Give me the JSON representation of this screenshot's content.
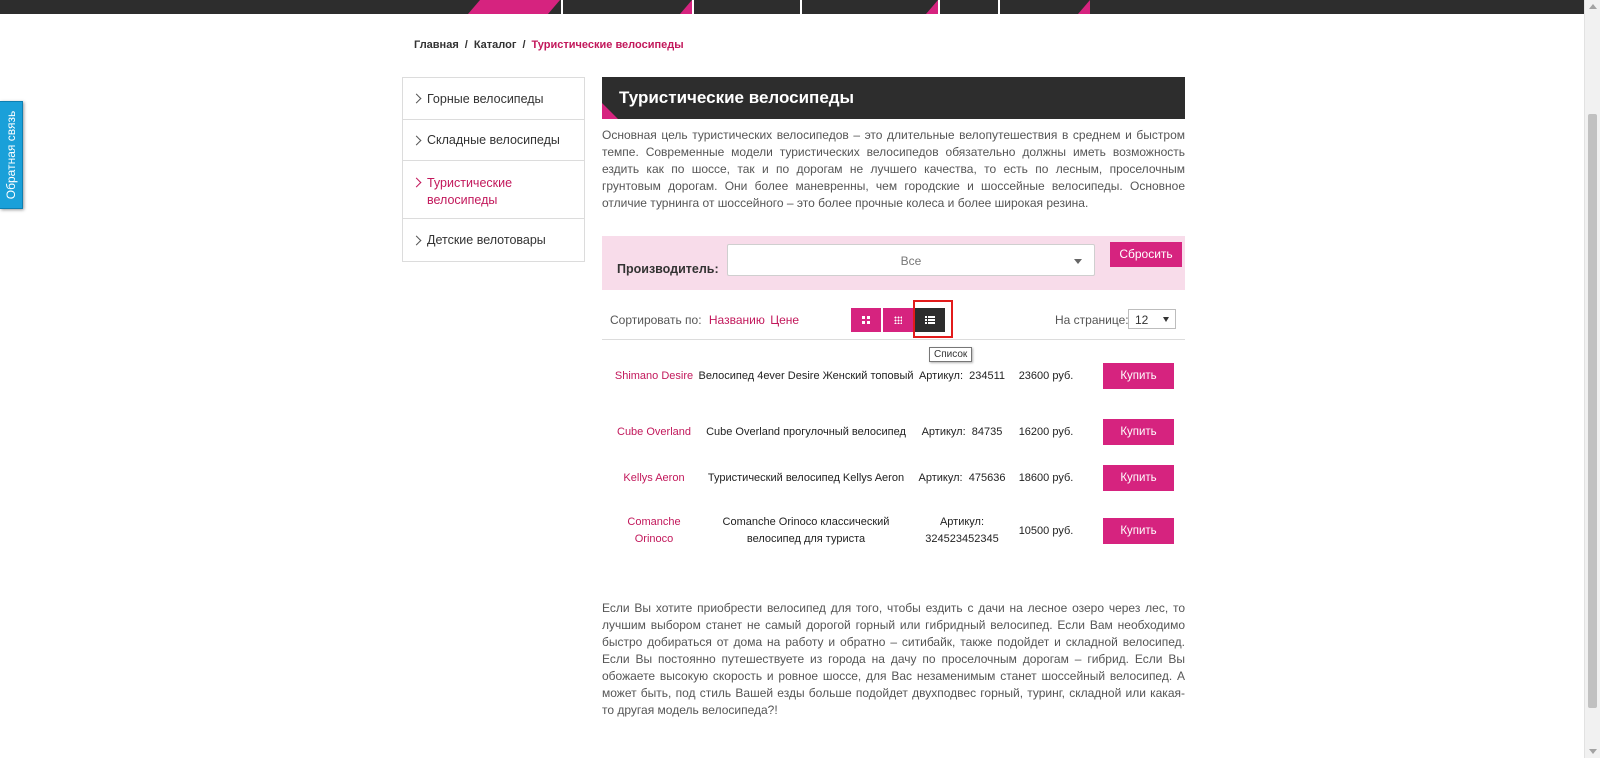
{
  "feedback": {
    "label": "Обратная связь"
  },
  "breadcrumb": {
    "home": "Главная",
    "catalog": "Каталог",
    "current": "Туристические велосипеды",
    "separator": "/"
  },
  "sidebar": {
    "items": [
      {
        "label": "Горные велосипеды",
        "active": false
      },
      {
        "label": "Складные велосипеды",
        "active": false
      },
      {
        "label": "Туристические велосипеды",
        "active": true
      },
      {
        "label": "Детские велотовары",
        "active": false
      }
    ]
  },
  "page": {
    "title": "Туристические велосипеды",
    "description": "Основная цель туристических велосипедов – это длительные велопутешествия в среднем и быстром темпе. Современные модели туристических велосипедов обязательно должны иметь возможность ездить как по шоссе, так и по дорогам не лучшего качества, то есть по лесным, проселочным грунтовым дорогам. Они более маневренны, чем городские и шоссейные велосипеды. Основное отличие турнинга от шоссейного – это более прочные колеса и более широкая резина.",
    "bottom_text": "Если Вы хотите приобрести велосипед для того, чтобы ездить с дачи на лесное озеро через лес, то лучшим выбором станет не самый дорогой горный или гибридный велосипед. Если Вам необходимо быстро добираться от дома на работу и обратно – ситибайк, также подойдет и складной велосипед. Если Вы постоянно путешествуете из города на дачу по проселочным дорогам – гибрид. Если Вы обожаете высокую скорость и ровное шоссе, для Вас незаменимым станет шоссейный велосипед. А может быть, под стиль Вашей езды больше подойдет двухподвес горный, туринг, складной или какая-то другая модель велосипеда?!"
  },
  "filter": {
    "label": "Производитель:",
    "selected": "Все",
    "reset_label": "Сбросить"
  },
  "sort": {
    "label": "Сортировать по:",
    "by_name": "Названию",
    "by_price": "Цене"
  },
  "views": {
    "tooltip": "Список",
    "active": "list"
  },
  "perpage": {
    "label": "На странице:",
    "value": "12"
  },
  "products": [
    {
      "name": "Shimano Desire",
      "title": "Велосипед 4ever Desire Женский топовый",
      "sku_label": "Артикул:",
      "sku": "234511",
      "price": "23600 руб.",
      "buy": "Купить"
    },
    {
      "name": "Cube Overland",
      "title": "Cube Overland прогулочный велосипед",
      "sku_label": "Артикул:",
      "sku": "84735",
      "price": "16200 руб.",
      "buy": "Купить"
    },
    {
      "name": "Kellys Aeron",
      "title": "Туристический велосипед Kellys Aeron",
      "sku_label": "Артикул:",
      "sku": "475636",
      "price": "18600 руб.",
      "buy": "Купить"
    },
    {
      "name": "Comanche Orinoco",
      "title": "Comanche Orinoco классический велосипед для туриста",
      "sku_label": "Артикул:",
      "sku": "324523452345",
      "price": "10500 руб.",
      "buy": "Купить"
    }
  ],
  "colors": {
    "accent": "#d6237f",
    "dark": "#2d2d2d",
    "filter_bg": "#f8dcea",
    "feedback": "#1aa0d9"
  }
}
